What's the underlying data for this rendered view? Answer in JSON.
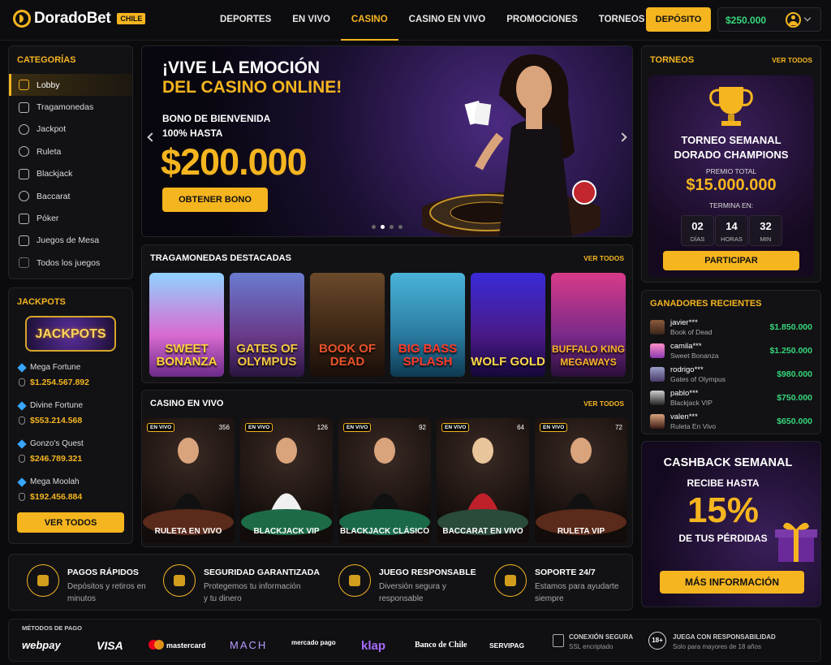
{
  "header": {
    "logo": "DoradoBet",
    "badge": "CHILE",
    "nav": [
      {
        "label": "DEPORTES"
      },
      {
        "label": "EN VIVO"
      },
      {
        "label": "CASINO"
      },
      {
        "label": "CASINO EN VIVO"
      },
      {
        "label": "PROMOCIONES"
      },
      {
        "label": "TORNEOS"
      }
    ],
    "deposit": "DEPÓSITO",
    "balance": "$250.000"
  },
  "categories": {
    "title": "CATEGORÍAS",
    "items": [
      "Lobby",
      "Tragamonedas",
      "Jackpot",
      "Ruleta",
      "Blackjack",
      "Baccarat",
      "Póker",
      "Juegos de Mesa",
      "Todos los juegos"
    ]
  },
  "jackpots": {
    "title": "JACKPOTS",
    "logo": "JACKPOTS",
    "items": [
      {
        "name": "Mega Fortune",
        "value": "$1.254.567.892"
      },
      {
        "name": "Divine Fortune",
        "value": "$553.214.568"
      },
      {
        "name": "Gonzo's Quest",
        "value": "$246.789.321"
      },
      {
        "name": "Mega Moolah",
        "value": "$192.456.884"
      }
    ],
    "button": "VER TODOS"
  },
  "hero": {
    "line1": "¡VIVE LA EMOCIÓN",
    "line2": "DEL CASINO ONLINE!",
    "sub1": "BONO DE BIENVENIDA",
    "sub2": "100% HASTA",
    "amount": "$200.000",
    "button": "OBTENER BONO"
  },
  "slots": {
    "title": "TRAGAMONEDAS DESTACADAS",
    "link": "VER TODOS",
    "games": [
      {
        "name": "SWEET BONANZA",
        "color": "#e23a86"
      },
      {
        "name": "GATES OF OLYMPUS",
        "color": "#f1b93a"
      },
      {
        "name": "BOOK OF DEAD",
        "color": "#d94a2a"
      },
      {
        "name": "BIG BASS SPLASH",
        "color": "#e8352c"
      },
      {
        "name": "WOLF GOLD",
        "color": "#f5c842"
      },
      {
        "name": "BUFFALO KING MEGAWAYS",
        "color": "#f5a623"
      }
    ]
  },
  "live": {
    "title": "CASINO EN VIVO",
    "link": "VER TODOS",
    "badge": "EN VIVO",
    "tables": [
      {
        "name": "RULETA EN VIVO",
        "count": "356",
        "felt": "#5a2a1a"
      },
      {
        "name": "BLACKJACK VIP",
        "count": "126",
        "felt": "#1d6b46"
      },
      {
        "name": "BLACKJACK CLÁSICO",
        "count": "92",
        "felt": "#1a6a4a"
      },
      {
        "name": "BACCARAT EN VIVO",
        "count": "64",
        "felt": "#2a4a3a"
      },
      {
        "name": "RULETA VIP",
        "count": "72",
        "felt": "#5a2a1a"
      }
    ]
  },
  "tournament": {
    "title": "TORNEOS",
    "link": "VER TODOS",
    "name1": "TORNEO SEMANAL",
    "name2": "DORADO CHAMPIONS",
    "prize_label": "PREMIO TOTAL",
    "prize": "$15.000.000",
    "ends": "TERMINA EN:",
    "countdown": [
      {
        "num": "02",
        "label": "DÍAS"
      },
      {
        "num": "14",
        "label": "HORAS"
      },
      {
        "num": "32",
        "label": "MIN"
      }
    ],
    "button": "PARTICIPAR"
  },
  "winners": {
    "title": "GANADORES RECIENTES",
    "items": [
      {
        "user": "javier***",
        "game": "Book of Dead",
        "amount": "$1.850.000"
      },
      {
        "user": "camila***",
        "game": "Sweet Bonanza",
        "amount": "$1.250.000"
      },
      {
        "user": "rodrigo***",
        "game": "Gates of Olympus",
        "amount": "$980.000"
      },
      {
        "user": "pablo***",
        "game": "Blackjack VIP",
        "amount": "$750.000"
      },
      {
        "user": "valen***",
        "game": "Ruleta En Vivo",
        "amount": "$650.000"
      }
    ]
  },
  "cashback": {
    "title": "CASHBACK SEMANAL",
    "sub": "RECIBE HASTA",
    "pct": "15%",
    "sub2": "DE TUS PÉRDIDAS",
    "button": "MÁS INFORMACIÓN"
  },
  "features": [
    {
      "title": "PAGOS RÁPIDOS",
      "desc": "Depósitos y retiros en minutos"
    },
    {
      "title": "SEGURIDAD GARANTIZADA",
      "desc": "Protegemos tu información y tu dinero"
    },
    {
      "title": "JUEGO RESPONSABLE",
      "desc": "Diversión segura y responsable"
    },
    {
      "title": "SOPORTE 24/7",
      "desc": "Estamos para ayudarte siempre"
    }
  ],
  "footer": {
    "pay_label": "MÉTODOS DE PAGO",
    "methods": [
      "webpay",
      "VISA",
      "mastercard",
      "MACH",
      "mercado pago",
      "klap",
      "Banco de Chile",
      "SERVIPAG"
    ],
    "secure_title": "CONEXIÓN SEGURA",
    "secure_desc": "SSL encriptado",
    "resp_title": "JUEGA CON RESPONSABILIDAD",
    "resp_desc": "Solo para mayores de 18 años",
    "age": "18+"
  }
}
